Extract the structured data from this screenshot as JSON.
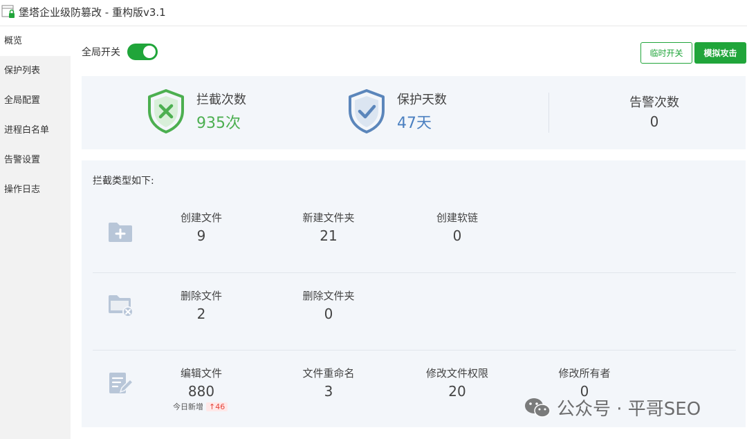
{
  "window": {
    "title": "堡塔企业级防篡改 - 重构版v3.1"
  },
  "sidebar": {
    "items": [
      {
        "label": "概览"
      },
      {
        "label": "保护列表"
      },
      {
        "label": "全局配置"
      },
      {
        "label": "进程白名单"
      },
      {
        "label": "告警设置"
      },
      {
        "label": "操作日志"
      }
    ]
  },
  "toolbar": {
    "global_switch_label": "全局开关",
    "global_switch_on": true,
    "temp_switch_label": "临时开关",
    "simulate_attack_label": "模拟攻击"
  },
  "summary": {
    "intercepts": {
      "label": "拦截次数",
      "value": "935次",
      "color": "#4caf50"
    },
    "protect_days": {
      "label": "保护天数",
      "value": "47天",
      "color": "#4a7fc0"
    },
    "alerts": {
      "label": "告警次数",
      "value": "0"
    }
  },
  "detail": {
    "title": "拦截类型如下:",
    "rows": [
      {
        "icon": "folder-add-icon",
        "cells": [
          {
            "label": "创建文件",
            "value": "9"
          },
          {
            "label": "新建文件夹",
            "value": "21"
          },
          {
            "label": "创建软链",
            "value": "0"
          }
        ]
      },
      {
        "icon": "folder-delete-icon",
        "cells": [
          {
            "label": "删除文件",
            "value": "2"
          },
          {
            "label": "删除文件夹",
            "value": "0"
          }
        ]
      },
      {
        "icon": "edit-file-icon",
        "cells": [
          {
            "label": "编辑文件",
            "value": "880"
          },
          {
            "label": "文件重命名",
            "value": "3"
          },
          {
            "label": "修改文件权限",
            "value": "20"
          },
          {
            "label": "修改所有者",
            "value": "0"
          }
        ],
        "today_label": "今日新增",
        "today_value": "↑46"
      }
    ]
  },
  "watermark": {
    "text": "公众号 · 平哥SEO"
  },
  "colors": {
    "accent": "#20a53a",
    "panel_bg": "#f3f6fa",
    "icon_gray": "#b8c6d8",
    "badge_red": "#e5443a"
  }
}
